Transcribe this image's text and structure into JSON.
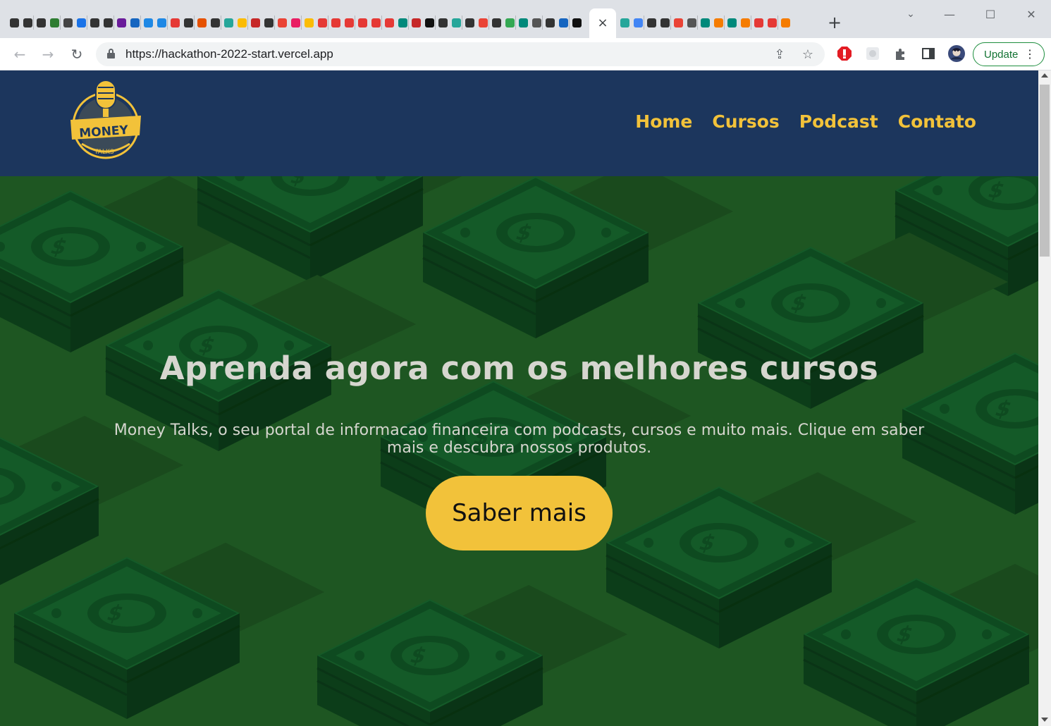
{
  "browser": {
    "active_tab_close": "×",
    "new_tab": "+",
    "url": "https://hackathon-2022-start.vercel.app",
    "update_label": "Update",
    "window": {
      "minimize": "—",
      "maximize": "☐",
      "close": "✕"
    }
  },
  "site": {
    "logo_text_main": "MONEY",
    "logo_text_sub": "TALKS",
    "nav": [
      {
        "label": "Home"
      },
      {
        "label": "Cursos"
      },
      {
        "label": "Podcast"
      },
      {
        "label": "Contato"
      }
    ],
    "hero": {
      "title": "Aprenda agora com os melhores cursos",
      "subtitle": "Money Talks, o seu portal de informacao financeira com podcasts, cursos e muito mais. Clique em saber mais e descubra nossos produtos.",
      "cta_label": "Saber mais"
    }
  },
  "colors": {
    "header_bg": "#1c365d",
    "accent": "#f2c23a",
    "hero_bg": "#1e5622",
    "hero_text": "#d6d6cf"
  }
}
